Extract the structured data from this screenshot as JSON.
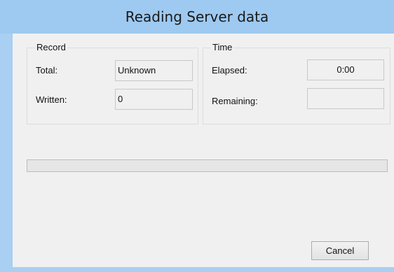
{
  "window": {
    "title": "Reading Server data"
  },
  "record": {
    "legend": "Record",
    "total_label": "Total:",
    "total_value": "Unknown",
    "written_label": "Written:",
    "written_value": "0"
  },
  "time": {
    "legend": "Time",
    "elapsed_label": "Elapsed:",
    "elapsed_value": "0:00",
    "remaining_label": "Remaining:",
    "remaining_value": ""
  },
  "progress": {
    "fraction": 0
  },
  "buttons": {
    "cancel_label": "Cancel"
  },
  "colors": {
    "titlebar": "#9ec9f1",
    "dialog_bg": "#f0f0f0",
    "progress_fill": "#06b025"
  }
}
